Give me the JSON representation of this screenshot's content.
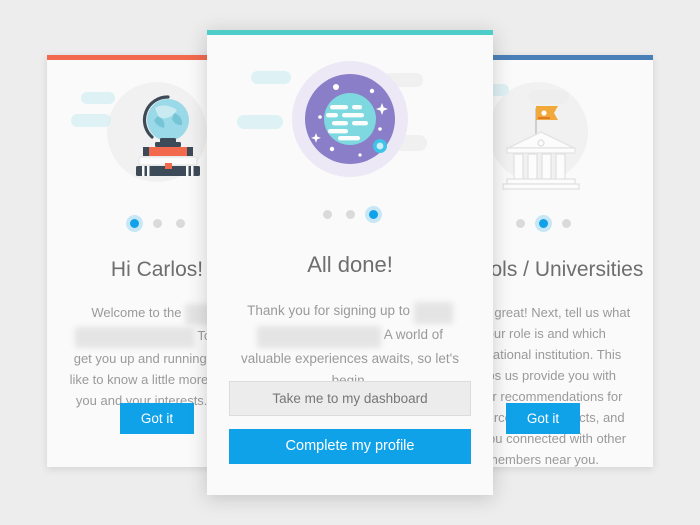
{
  "background_color": "#ededed",
  "accent_colors": {
    "left_card_bar": "#f2694e",
    "center_card_bar": "#4ecdc9",
    "right_card_bar": "#4a80b8",
    "primary_button": "#10a2e8",
    "active_dot": "#10a2e8",
    "inactive_dot": "#dadada"
  },
  "cards": {
    "left": {
      "accent_color": "#f2694e",
      "illustration": "globe-on-books-icon",
      "dots": {
        "count": 3,
        "active_index": 0
      },
      "title": "Hi Carlos!",
      "body_parts": [
        {
          "type": "text",
          "value": "Welcome to the "
        },
        {
          "type": "redacted",
          "value": "Global"
        },
        {
          "type": "text",
          "value": " "
        },
        {
          "type": "redacted",
          "value": "Education Exchange"
        },
        {
          "type": "text",
          "value": " To help get you up and running, we'd like to know a little more about you and your interests. Let's begin."
        }
      ],
      "button_label": "Got it"
    },
    "center": {
      "accent_color": "#4ecdc9",
      "illustration": "planet-globe-icon",
      "dots": {
        "count": 3,
        "active_index": 2
      },
      "title": "All done!",
      "body_parts": [
        {
          "type": "text",
          "value": "Thank you for signing up to "
        },
        {
          "type": "redacted",
          "value": "Global"
        },
        {
          "type": "text",
          "value": " "
        },
        {
          "type": "redacted",
          "value": "Education Exchange"
        },
        {
          "type": "text",
          "value": " A world of valuable experiences awaits, so let's begin."
        }
      ],
      "secondary_button_label": "Take me to my dashboard",
      "primary_button_label": "Complete my profile"
    },
    "right": {
      "accent_color": "#4a80b8",
      "illustration": "university-building-icon",
      "dots": {
        "count": 3,
        "active_index": 1
      },
      "title": "Schools / Universities",
      "body_parts": [
        {
          "type": "text",
          "value": "That's great! Next, tell us what your role is and which educational institution. This helps us provide you with better recommendations for resources and contacts, and get you connected with other members near you."
        }
      ],
      "button_label": "Got it"
    }
  }
}
